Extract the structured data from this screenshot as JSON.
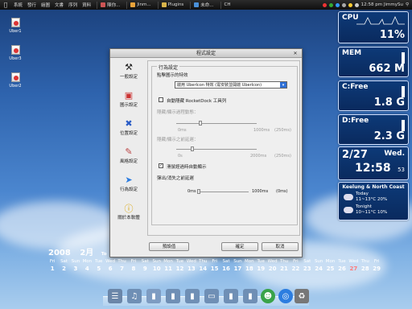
{
  "menubar": {
    "menus": [
      "系統",
      "發行",
      "繪圖",
      "文書",
      "序列",
      "資料"
    ],
    "tasks": [
      "陳你...",
      "Jinm...",
      "Plugins",
      "未命...",
      "CH"
    ],
    "clock": "12:58 pm JimmySu"
  },
  "desktop_icons": [
    "Uber1",
    "Uber3",
    "Uber2"
  ],
  "widgets": {
    "cpu": {
      "label": "CPU",
      "value": "11%"
    },
    "mem": {
      "label": "MEM",
      "value": "662 M"
    },
    "c_drive": {
      "label": "C:Free",
      "value": "1.8 G"
    },
    "d_drive": {
      "label": "D:Free",
      "value": "2.3 G"
    },
    "date": {
      "day": "2/27",
      "weekday": "Wed.",
      "time": "12:58",
      "seconds": "53"
    },
    "weather": {
      "location": "Keelung & North Coast",
      "today_label": "Today",
      "today_temp": "11~13°C 20%",
      "tonight_label": "Tonight",
      "tonight_temp": "10~11°C 10%"
    }
  },
  "dialog": {
    "title": "程式設定",
    "sidebar": [
      "一般設定",
      "圖示設定",
      "位置設定",
      "風格設定",
      "行為設定",
      "關於本軟體"
    ],
    "group_title": "行為設定",
    "click_label": "點擊圖示的特效",
    "click_select": "啟用 UberIcon 特效 (需安裝並開啟 UberIcon)",
    "hide_rocketdock": "自動隱藏 RocketDock 工具列",
    "hide_delay_label": "隱藏/顯示過程動態：",
    "hide_delay_min": "0ms",
    "hide_delay_max": "1000ms",
    "hide_delay_value": "(250ms)",
    "show_delay_label": "隱藏/顯示之前延遲：",
    "show_delay_min": "0s",
    "show_delay_max": "2000ms",
    "show_delay_value": "(250ms)",
    "mouse_hover": "滑鼠經過時自動顯示",
    "popup_delay_label": "彈出/消失之前延遲",
    "popup_min": "0ms",
    "popup_max": "1000ms",
    "popup_value": "(0ms)",
    "btn_default": "預設值",
    "btn_ok": "確定",
    "btn_cancel": "取消"
  },
  "calendar": {
    "year": "2008",
    "month": "2月",
    "days": [
      [
        "Fri",
        "1"
      ],
      [
        "Sat",
        "2"
      ],
      [
        "Sun",
        "3"
      ],
      [
        "Mon",
        "4"
      ],
      [
        "Tue",
        "5"
      ],
      [
        "Wed",
        "6"
      ],
      [
        "Thu",
        "7"
      ],
      [
        "Fri",
        "8"
      ],
      [
        "Sat",
        "9"
      ],
      [
        "Sun",
        "10"
      ],
      [
        "Mon",
        "11"
      ],
      [
        "Tue",
        "12"
      ],
      [
        "Wed",
        "13"
      ],
      [
        "Thu",
        "14"
      ],
      [
        "Fri",
        "15"
      ],
      [
        "Sat",
        "16"
      ],
      [
        "Sun",
        "17"
      ],
      [
        "Mon",
        "18"
      ],
      [
        "Tue",
        "19"
      ],
      [
        "Wed",
        "20"
      ],
      [
        "Thu",
        "21"
      ],
      [
        "Fri",
        "22"
      ],
      [
        "Sat",
        "23"
      ],
      [
        "Sun",
        "24"
      ],
      [
        "Mon",
        "25"
      ],
      [
        "Tue",
        "26"
      ],
      [
        "Wed",
        "27"
      ],
      [
        "Thu",
        "28"
      ],
      [
        "Fri",
        "29"
      ]
    ],
    "today_index": 26,
    "partial_label": "To"
  },
  "colors": {
    "widget_bg": "#0d3a78",
    "today": "#ff7b7b",
    "select_accent": "#2d6fd6"
  }
}
